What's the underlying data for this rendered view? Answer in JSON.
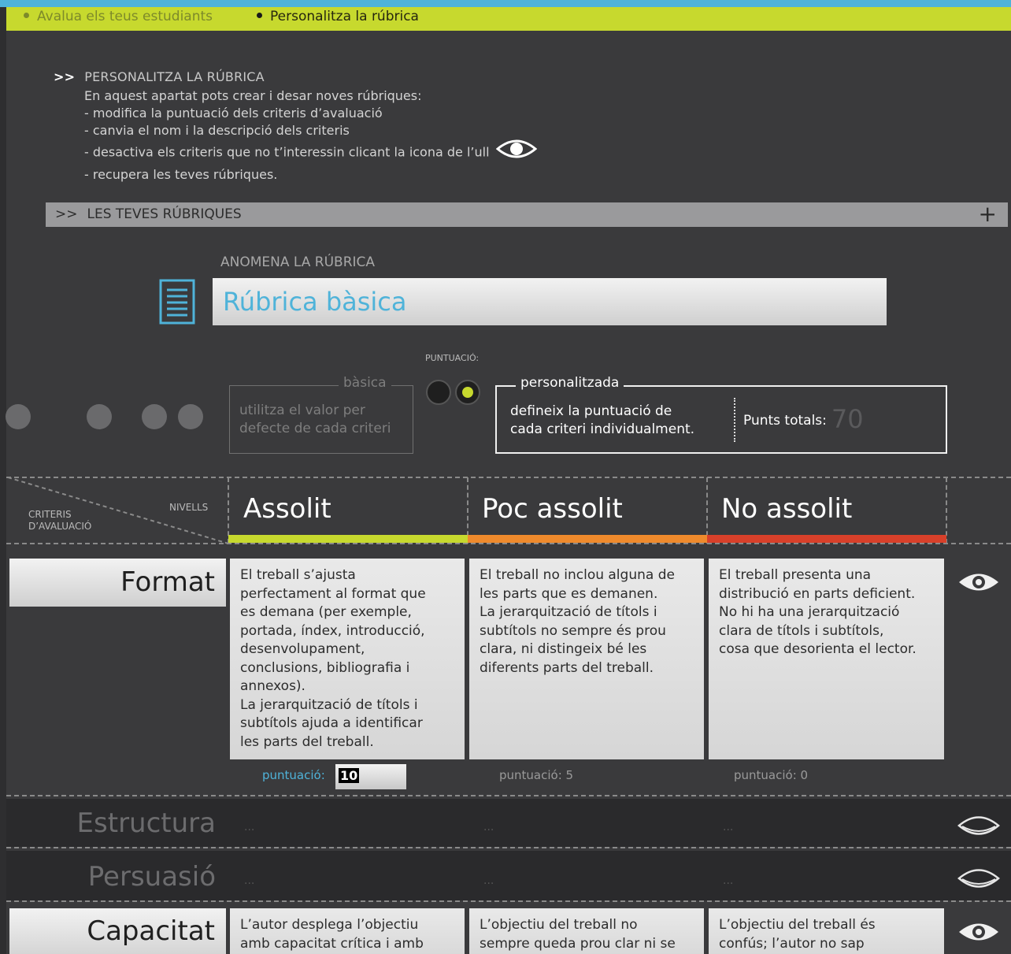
{
  "breadcrumb": {
    "items": [
      "Avalua els teus estudiants",
      "Personalitza la rúbrica"
    ]
  },
  "intro": {
    "arrow": ">>",
    "heading": "PERSONALITZA LA RÚBRICA",
    "lines": [
      "En aquest apartat pots crear i desar noves rúbriques:",
      "- modifica la puntuació dels criteris d’avaluació",
      "- canvia el nom i la descripció dels criteris",
      "- desactiva els criteris que no t’interessin clicant la icona de l’ull",
      "- recupera les teves rúbriques."
    ]
  },
  "rubrics_bar": {
    "arrow": ">>",
    "label": "LES TEVES RÚBRIQUES",
    "add": "+"
  },
  "rubric_name": {
    "label": "ANOMENA LA RÚBRICA",
    "value": "Rúbrica bàsica"
  },
  "scoring": {
    "label": "PUNTUACIÓ:",
    "basic": {
      "title": "bàsica",
      "line1": "utilitza el valor per",
      "line2": "defecte de cada criteri"
    },
    "custom": {
      "title": "personalitzada",
      "line1": "defineix la puntuació de",
      "line2": "cada criteri individualment.",
      "total_label": "Punts totals:",
      "total_value": "70"
    },
    "selected": "personalitzada"
  },
  "grid": {
    "corner": {
      "levels_label": "NIVELLS",
      "criteria_line1": "CRITERIS",
      "criteria_line2": "D’AVALUACIÓ"
    },
    "levels": [
      {
        "name": "Assolit",
        "color": "#c7d92e"
      },
      {
        "name": "Poc assolit",
        "color": "#ef8a2c"
      },
      {
        "name": "No assolit",
        "color": "#d8402a"
      }
    ],
    "criteria": [
      {
        "name": "Format",
        "active": true,
        "cells": [
          "El treball s’ajusta\nperfectament al format que\nes demana (per exemple,\nportada, índex, introducció,\ndesenvolupament,\nconclusions, bibliografia i\nannexos).\nLa jerarquització de títols i\nsubtítols ajuda a identificar\nles parts del treball.",
          "El treball no inclou alguna de\nles parts que es demanen.\nLa jerarquització de títols i\nsubtítols no sempre és prou\nclara, ni distingeix bé les\ndiferents parts del treball.",
          "El treball presenta una\ndistribució en parts deficient.\nNo hi ha una jerarquització\nclara de títols i subtítols,\ncosa que desorienta el lector."
        ],
        "score_label": "puntuació:",
        "scores": [
          "10",
          "5",
          "0"
        ]
      },
      {
        "name": "Estructura",
        "active": false,
        "placeholder": "..."
      },
      {
        "name": "Persuasió",
        "active": false,
        "placeholder": "..."
      },
      {
        "name": "Capacitat",
        "active": true,
        "cells": [
          "L’autor desplega l’objectiu\namb capacitat crítica i amb",
          "L’objectiu del treball no\nsempre queda prou clar ni se",
          "L’objectiu del treball és\nconfús; l’autor no sap"
        ]
      }
    ]
  },
  "colors": {
    "accent": "#4fb3d9",
    "lime": "#c7d92e",
    "background": "#3a3a3c"
  },
  "icons": [
    "eye-icon",
    "document-icon",
    "plus-icon"
  ]
}
